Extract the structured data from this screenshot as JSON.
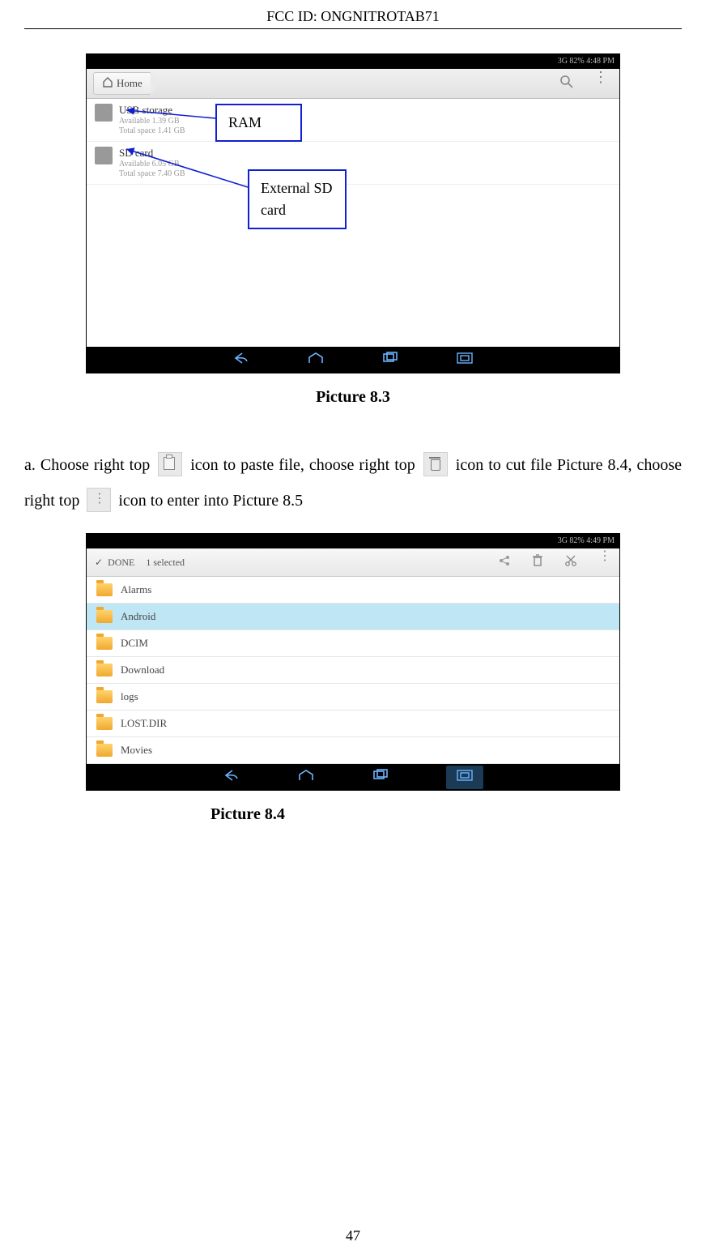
{
  "header": {
    "fcc_id": "FCC ID: ONGNITROTAB71"
  },
  "figure1": {
    "status": "3G  82%  4:48 PM",
    "home_label": "Home",
    "rows": [
      {
        "title": "USB storage",
        "sub1": "Available 1.39 GB",
        "sub2": "Total space 1.41 GB"
      },
      {
        "title": "SD card",
        "sub1": "Available 6.05 GB",
        "sub2": "Total space 7.40 GB"
      }
    ],
    "callouts": {
      "ram": "RAM",
      "sd": "External SD card"
    },
    "caption": "Picture 8.3"
  },
  "paragraph": {
    "p1a": "a. Choose right top ",
    "p1b": " icon to paste file, choose right top ",
    "p1c": " icon to cut file Picture 8.4, choose right top ",
    "p1d": " icon to enter into Picture 8.5"
  },
  "figure2": {
    "status": "3G  82%  4:49 PM",
    "done": "DONE",
    "selected_count": "1 selected",
    "folders": [
      "Alarms",
      "Android",
      "DCIM",
      "Download",
      "logs",
      "LOST.DIR",
      "Movies"
    ],
    "selected_index": 1,
    "caption": "Picture 8.4"
  },
  "page_number": "47"
}
